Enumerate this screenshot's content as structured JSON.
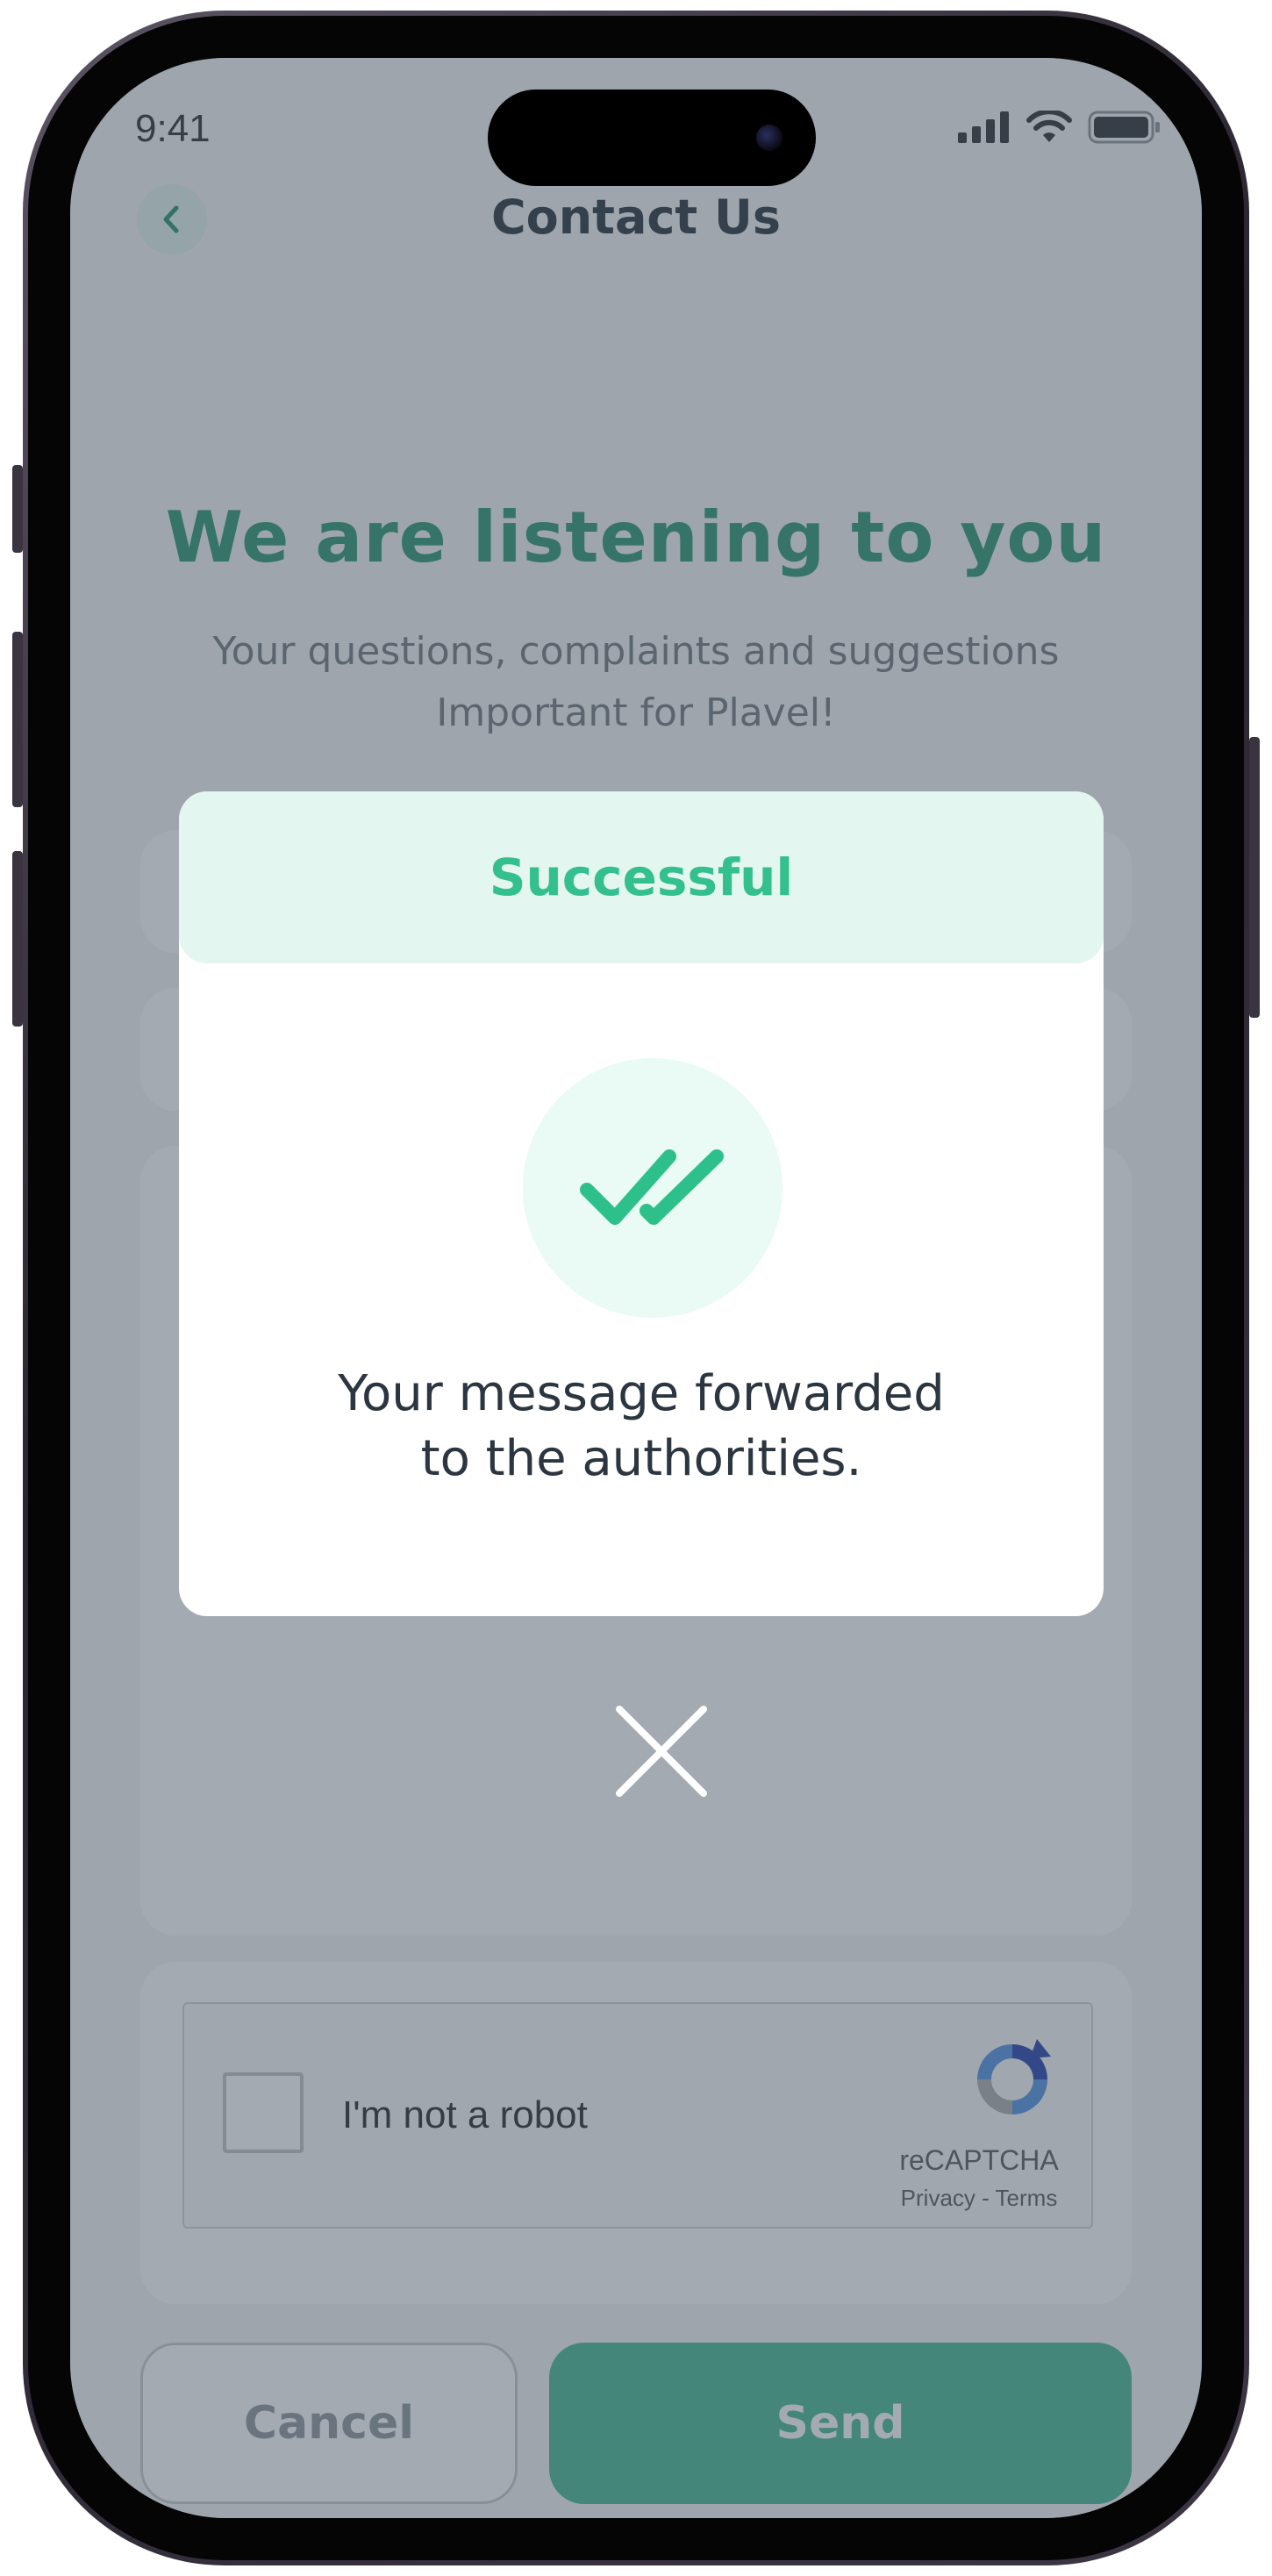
{
  "status_bar": {
    "time": "9:41",
    "icons": [
      "signal-icon",
      "wifi-icon",
      "battery-icon"
    ]
  },
  "header": {
    "back_icon": "chevron-left-icon",
    "title": "Contact Us"
  },
  "hero": {
    "title": "We are listening to you",
    "subtitle_line1": "Your questions, complaints and suggestions",
    "subtitle_line2": "Important for Plavel!"
  },
  "captcha": {
    "label": "I'm not a robot",
    "brand": "reCAPTCHA",
    "links": "Privacy - Terms"
  },
  "actions": {
    "cancel_label": "Cancel",
    "send_label": "Send"
  },
  "modal": {
    "title": "Successful",
    "icon": "double-check-icon",
    "message_line1": "Your message forwarded",
    "message_line2": "to the authorities.",
    "close_icon": "close-icon"
  },
  "colors": {
    "accent": "#3fb78f",
    "accent_dark": "#23936b",
    "modal_header_bg": "#e3f6f0",
    "overlay": "rgba(74,86,100,0.5)"
  }
}
